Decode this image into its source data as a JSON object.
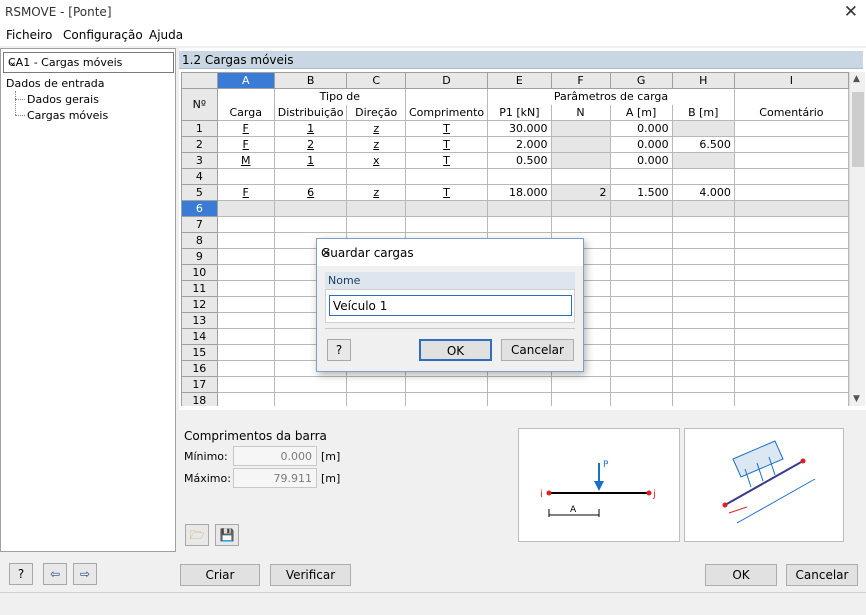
{
  "window": {
    "title": "RSMOVE - [Ponte]"
  },
  "menu": [
    "Ficheiro",
    "Configuração",
    "Ajuda"
  ],
  "navigator": {
    "case": "CA1 - Cargas móveis",
    "tree": {
      "root": "Dados de entrada",
      "items": [
        "Dados gerais",
        "Cargas móveis"
      ]
    }
  },
  "table": {
    "title": "1.2 Cargas móveis",
    "col_letters": [
      "A",
      "B",
      "C",
      "D",
      "E",
      "F",
      "G",
      "H",
      "I"
    ],
    "group_headers": {
      "tipo": "Tipo de",
      "parametros": "Parâmetros de carga"
    },
    "row_header": "Nº",
    "col_headers": [
      "Carga",
      "Distribuição",
      "Direção",
      "Comprimento",
      "P1 [kN]",
      "N",
      "A [m]",
      "B [m]",
      "Comentário"
    ],
    "rows": [
      {
        "n": "1",
        "carga": "F",
        "dist": "1",
        "dir": "z",
        "comp": "T",
        "p1": "30.000",
        "N": "",
        "A": "0.000",
        "B": "",
        "com": ""
      },
      {
        "n": "2",
        "carga": "F",
        "dist": "2",
        "dir": "z",
        "comp": "T",
        "p1": "2.000",
        "N": "",
        "A": "0.000",
        "B": "6.500",
        "com": ""
      },
      {
        "n": "3",
        "carga": "M",
        "dist": "1",
        "dir": "x",
        "comp": "T",
        "p1": "0.500",
        "N": "",
        "A": "0.000",
        "B": "",
        "com": ""
      },
      {
        "n": "4",
        "carga": "",
        "dist": "",
        "dir": "",
        "comp": "",
        "p1": "",
        "N": "",
        "A": "",
        "B": "",
        "com": ""
      },
      {
        "n": "5",
        "carga": "F",
        "dist": "6",
        "dir": "z",
        "comp": "T",
        "p1": "18.000",
        "N": "2",
        "A": "1.500",
        "B": "4.000",
        "com": ""
      },
      {
        "n": "6",
        "carga": "",
        "dist": "",
        "dir": "",
        "comp": "",
        "p1": "",
        "N": "",
        "A": "",
        "B": "",
        "com": ""
      },
      {
        "n": "7",
        "carga": "",
        "dist": "",
        "dir": "",
        "comp": "",
        "p1": "",
        "N": "",
        "A": "",
        "B": "",
        "com": ""
      },
      {
        "n": "8",
        "carga": "",
        "dist": "",
        "dir": "",
        "comp": "",
        "p1": "",
        "N": "",
        "A": "",
        "B": "",
        "com": ""
      },
      {
        "n": "9",
        "carga": "",
        "dist": "",
        "dir": "",
        "comp": "",
        "p1": "",
        "N": "",
        "A": "",
        "B": "",
        "com": ""
      },
      {
        "n": "10",
        "carga": "",
        "dist": "",
        "dir": "",
        "comp": "",
        "p1": "",
        "N": "",
        "A": "",
        "B": "",
        "com": ""
      },
      {
        "n": "11",
        "carga": "",
        "dist": "",
        "dir": "",
        "comp": "",
        "p1": "",
        "N": "",
        "A": "",
        "B": "",
        "com": ""
      },
      {
        "n": "12",
        "carga": "",
        "dist": "",
        "dir": "",
        "comp": "",
        "p1": "",
        "N": "",
        "A": "",
        "B": "",
        "com": ""
      },
      {
        "n": "13",
        "carga": "",
        "dist": "",
        "dir": "",
        "comp": "",
        "p1": "",
        "N": "",
        "A": "",
        "B": "",
        "com": ""
      },
      {
        "n": "14",
        "carga": "",
        "dist": "",
        "dir": "",
        "comp": "",
        "p1": "",
        "N": "",
        "A": "",
        "B": "",
        "com": ""
      },
      {
        "n": "15",
        "carga": "",
        "dist": "",
        "dir": "",
        "comp": "",
        "p1": "",
        "N": "",
        "A": "",
        "B": "",
        "com": ""
      },
      {
        "n": "16",
        "carga": "",
        "dist": "",
        "dir": "",
        "comp": "",
        "p1": "",
        "N": "",
        "A": "",
        "B": "",
        "com": ""
      },
      {
        "n": "17",
        "carga": "",
        "dist": "",
        "dir": "",
        "comp": "",
        "p1": "",
        "N": "",
        "A": "",
        "B": "",
        "com": ""
      },
      {
        "n": "18",
        "carga": "",
        "dist": "",
        "dir": "",
        "comp": "",
        "p1": "",
        "N": "",
        "A": "",
        "B": "",
        "com": ""
      }
    ]
  },
  "bar_lengths": {
    "title": "Comprimentos da barra",
    "min_label": "Mínimo:",
    "min_value": "0.000",
    "min_unit": "[m]",
    "max_label": "Máximo:",
    "max_value": "79.911",
    "max_unit": "[m]"
  },
  "sketch": {
    "p_label": "P",
    "i_label": "i",
    "j_label": "j",
    "a_label": "A"
  },
  "buttons": {
    "criar": "Criar",
    "verificar": "Verificar",
    "ok": "OK",
    "cancelar": "Cancelar"
  },
  "dialog": {
    "title": "Guardar cargas",
    "field_label": "Nome",
    "field_value": "Veículo 1",
    "ok": "OK",
    "cancel": "Cancelar"
  },
  "colors": {
    "accent": "#3a7bd5",
    "header_bar": "#c8d7e3"
  }
}
